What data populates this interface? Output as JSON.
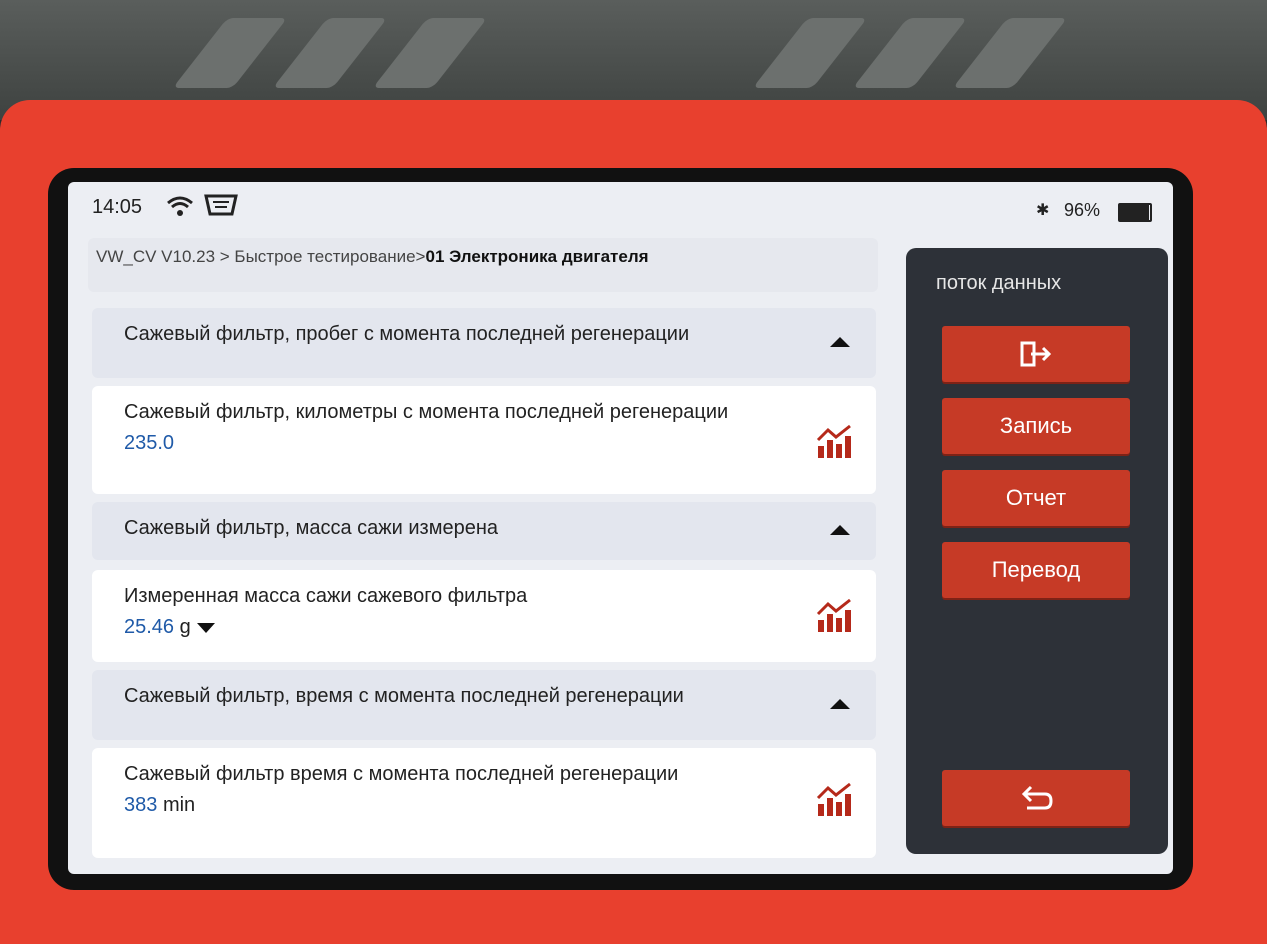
{
  "status": {
    "time": "14:05",
    "wifi_icon": "wifi-icon",
    "vci_icon": "vci-connector-icon",
    "bluetooth_icon": "bluetooth-icon",
    "battery_percent": "96%",
    "battery_level": 0.96
  },
  "breadcrumb": {
    "path": "VW_CV V10.23 > Быстрое тестирование>",
    "current": "01 Электроника двигателя"
  },
  "rows": [
    {
      "type": "group",
      "title": "Сажевый фильтр, пробег с момента последней регенерации",
      "icon": "collapse-triangle-icon"
    },
    {
      "type": "item",
      "title": "Сажевый фильтр, километры с момента последней регенерации",
      "value": "235.0",
      "unit": "",
      "icon": "graph-icon"
    },
    {
      "type": "group",
      "title": "Сажевый фильтр, масса сажи измерена",
      "icon": "collapse-triangle-icon"
    },
    {
      "type": "item",
      "title": "Измеренная масса сажи сажевого фильтра",
      "value": "25.46",
      "unit": "g",
      "icon": "graph-icon"
    },
    {
      "type": "group",
      "title": "Сажевый фильтр, время с момента последней регенерации",
      "icon": "collapse-triangle-icon"
    },
    {
      "type": "item",
      "title": "Сажевый фильтр время с момента последней регенерации",
      "value": "383",
      "unit": "min",
      "icon": "graph-icon"
    }
  ],
  "panel": {
    "title": "поток данных",
    "exit_icon": "exit-icon",
    "record_label": "Запись",
    "report_label": "Отчет",
    "translate_label": "Перевод",
    "back_icon": "back-arrow-icon"
  },
  "colors": {
    "accent_red": "#c63a26",
    "device_red": "#e8402e",
    "value_blue": "#1f5aa8",
    "panel_dark": "#2d3138"
  }
}
